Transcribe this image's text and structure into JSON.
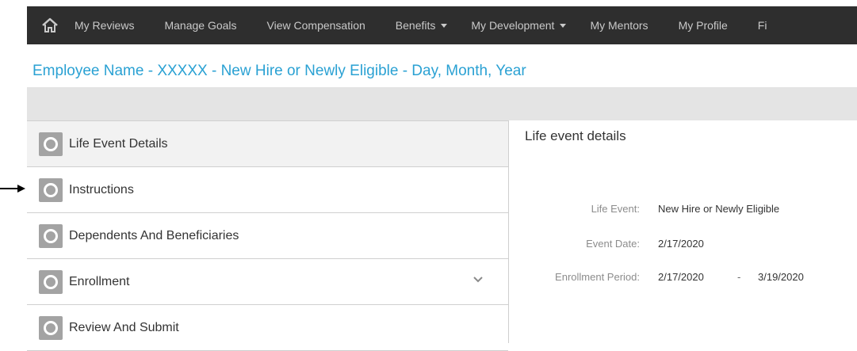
{
  "nav": {
    "items": [
      {
        "label": "My Reviews",
        "dropdown": false
      },
      {
        "label": "Manage Goals",
        "dropdown": false
      },
      {
        "label": "View Compensation",
        "dropdown": false
      },
      {
        "label": "Benefits",
        "dropdown": true
      },
      {
        "label": "My Development",
        "dropdown": true
      },
      {
        "label": "My Mentors",
        "dropdown": false
      },
      {
        "label": "My Profile",
        "dropdown": false
      },
      {
        "label": "Fi",
        "dropdown": false
      }
    ]
  },
  "page": {
    "title": "Employee Name - XXXXX - New Hire or Newly Eligible - Day, Month, Year"
  },
  "steps": [
    {
      "label": "Life Event Details",
      "active": true
    },
    {
      "label": "Instructions",
      "active": false
    },
    {
      "label": "Dependents And Beneficiaries",
      "active": false
    },
    {
      "label": "Enrollment",
      "active": false,
      "expandable": true
    },
    {
      "label": "Review And Submit",
      "active": false
    }
  ],
  "details": {
    "title": "Life event details",
    "life_event_label": "Life Event:",
    "life_event_value": "New Hire or Newly Eligible",
    "event_date_label": "Event Date:",
    "event_date_value": "2/17/2020",
    "enrollment_label": "Enrollment Period:",
    "enrollment_start": "2/17/2020",
    "enrollment_separator": "-",
    "enrollment_end": "3/19/2020"
  },
  "colors": {
    "navbar": "#2e2e2e",
    "title": "#2aa1d3",
    "badge": "#a3a3a3"
  }
}
